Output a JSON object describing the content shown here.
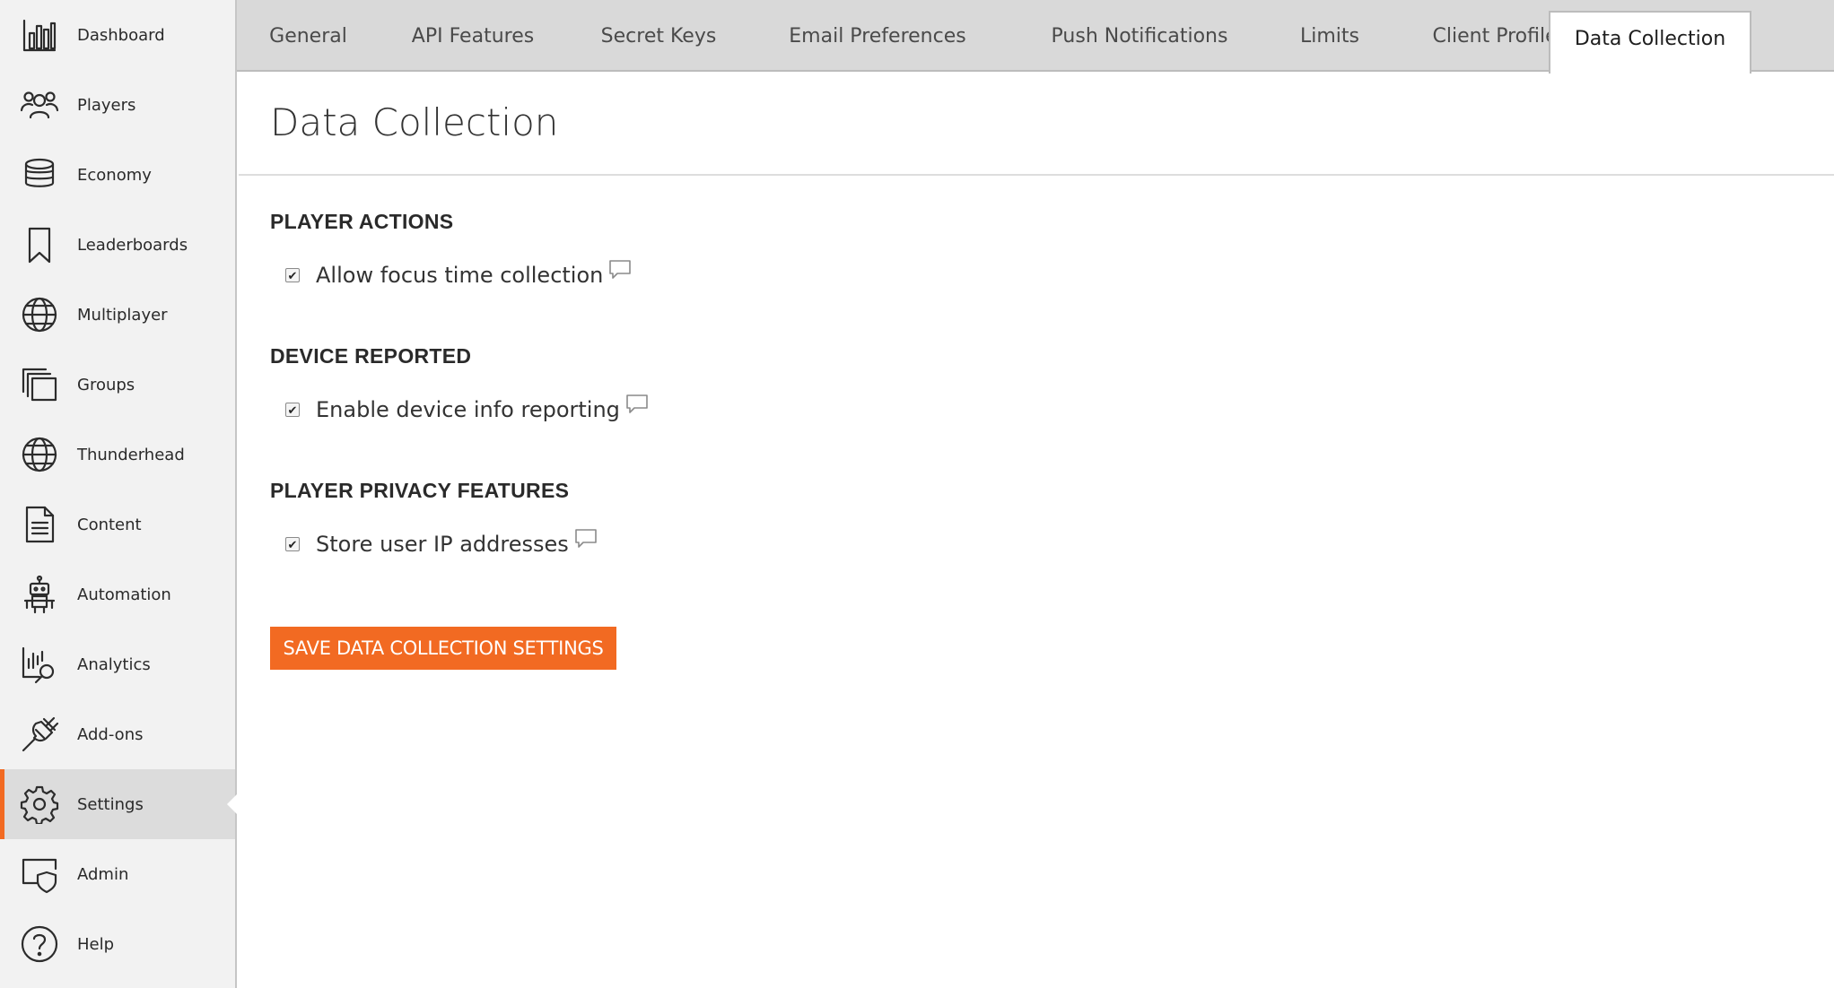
{
  "sidebar": {
    "items": [
      {
        "label": "Dashboard",
        "icon": "dashboard-icon"
      },
      {
        "label": "Players",
        "icon": "players-icon"
      },
      {
        "label": "Economy",
        "icon": "economy-icon"
      },
      {
        "label": "Leaderboards",
        "icon": "bookmark-icon"
      },
      {
        "label": "Multiplayer",
        "icon": "globe-icon"
      },
      {
        "label": "Groups",
        "icon": "groups-icon"
      },
      {
        "label": "Thunderhead",
        "icon": "globe-icon"
      },
      {
        "label": "Content",
        "icon": "document-icon"
      },
      {
        "label": "Automation",
        "icon": "robot-icon"
      },
      {
        "label": "Analytics",
        "icon": "analytics-icon"
      },
      {
        "label": "Add-ons",
        "icon": "plug-icon"
      },
      {
        "label": "Settings",
        "icon": "gear-icon",
        "active": true
      },
      {
        "label": "Admin",
        "icon": "admin-shield-icon"
      },
      {
        "label": "Help",
        "icon": "help-icon"
      }
    ]
  },
  "tabs": [
    {
      "label": "General"
    },
    {
      "label": "API Features"
    },
    {
      "label": "Secret Keys"
    },
    {
      "label": "Email Preferences"
    },
    {
      "label": "Push Notifications"
    },
    {
      "label": "Limits"
    },
    {
      "label": "Client Profile Options"
    },
    {
      "label": "Data Collection",
      "active": true
    }
  ],
  "main": {
    "title": "Data Collection",
    "sections": [
      {
        "heading": "PLAYER ACTIONS",
        "option": {
          "label": "Allow focus time collection",
          "checked": true
        }
      },
      {
        "heading": "DEVICE REPORTED",
        "option": {
          "label": "Enable device info reporting",
          "checked": true
        }
      },
      {
        "heading": "PLAYER PRIVACY FEATURES",
        "option": {
          "label": "Store user IP addresses",
          "checked": true
        }
      }
    ],
    "save_label": "SAVE DATA COLLECTION SETTINGS"
  },
  "colors": {
    "accent": "#f26a22",
    "sidebar_bg": "#f2f2f2",
    "tabbar_bg": "#d9d9d9"
  }
}
